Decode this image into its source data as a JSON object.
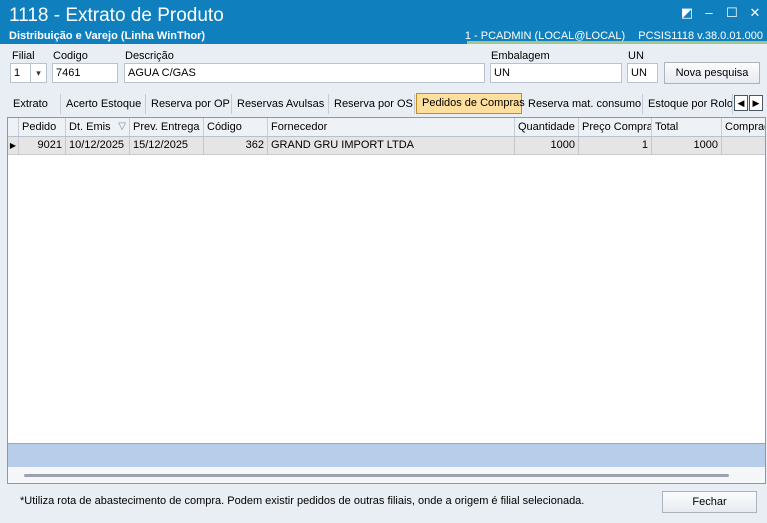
{
  "window": {
    "title": "1118 - Extrato de Produto",
    "subtitle": "Distribuição e Varejo (Linha WinThor)",
    "user_info": "1 - PCADMIN (LOCAL@LOCAL)",
    "version": "PCSIS1118  v.38.0.01.000",
    "controls": {
      "restore": "◩",
      "minimize": "–",
      "maximize": "☐",
      "close": "✕"
    }
  },
  "form": {
    "filial_label": "Filial",
    "filial_value": "1",
    "codigo_label": "Codigo",
    "codigo_value": "7461",
    "descricao_label": "Descrição",
    "descricao_value": "AGUA C/GAS",
    "embalagem_label": "Embalagem",
    "embalagem_value": "UN",
    "un_label": "UN",
    "un_value": "UN",
    "nova_pesquisa": "Nova pesquisa"
  },
  "tabs": [
    "Extrato",
    "Acerto Estoque",
    "Reserva por OP",
    "Reservas Avulsas",
    "Reserva por OS",
    "Pedidos de Compras",
    "Reserva mat. consumo",
    "Estoque por Rolo"
  ],
  "active_tab": "Pedidos de Compras",
  "grid": {
    "columns": [
      "Pedido",
      "Dt. Emis",
      "Prev. Entrega",
      "Código",
      "Fornecedor",
      "Quantidade",
      "Preço Compra",
      "Total",
      "Comprad"
    ],
    "rows": [
      [
        "9021",
        "10/12/2025",
        "15/12/2025",
        "362",
        "GRAND GRU IMPORT LTDA",
        "1000",
        "1",
        "1000",
        ""
      ]
    ]
  },
  "bottom": {
    "note": "*Utiliza rota de abastecimento de compra. Podem existir pedidos de outras filiais, onde a origem é filial selecionada.",
    "fechar": "Fechar"
  },
  "colors": {
    "titlebar": "#0f7fbe",
    "active_tab": "#ffdf9d",
    "footer_band": "#b7cdea"
  },
  "icons": {
    "restore": "restore-icon",
    "minimize": "minimize-icon",
    "maximize": "maximize-icon",
    "close": "close-icon",
    "combo": "chevron-down-icon",
    "row_indicator": "row-pointer-icon",
    "filter": "filter-icon"
  }
}
